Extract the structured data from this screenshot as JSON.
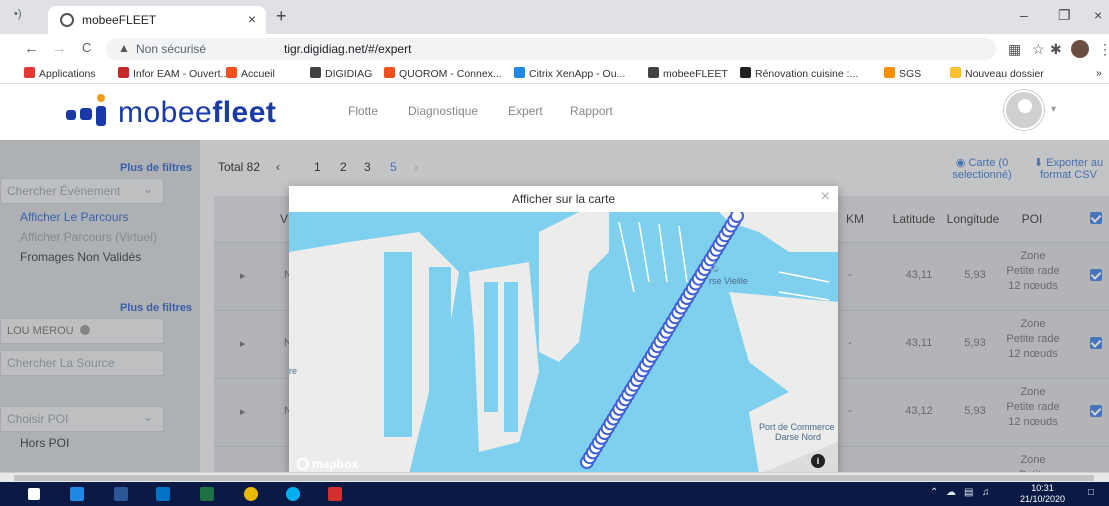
{
  "browser": {
    "tab_stub": "•)",
    "tab_title": "mobeeFLEET",
    "tab_close": "×",
    "new_tab": "+",
    "window_minimize": "–",
    "window_maximize": "❐",
    "window_close": "×",
    "back": "←",
    "forward": "→",
    "reload": "C",
    "security_label": "Non sécurisé",
    "url": "tigr.digidiag.net/#/expert",
    "bookmarks": [
      {
        "label": "Applications",
        "color": "#e53935"
      },
      {
        "label": "Infor EAM - Ouvert...",
        "color": "#c62828"
      },
      {
        "label": "Accueil",
        "color": "#f4511e"
      },
      {
        "label": "DIGIDIAG",
        "color": "#424242"
      },
      {
        "label": "QUOROM - Connex...",
        "color": "#f4511e"
      },
      {
        "label": "Citrix XenApp - Ou...",
        "color": "#1e88e5"
      },
      {
        "label": "mobeeFLEET",
        "color": "#424242"
      },
      {
        "label": "Rénovation cuisine :...",
        "color": "#212121"
      },
      {
        "label": "SGS",
        "color": "#ff8f00"
      },
      {
        "label": "Nouveau dossier",
        "color": "#fbc02d"
      }
    ],
    "bookmarks_more": "»"
  },
  "app": {
    "logo_text_light": "mobee",
    "logo_text_bold": "fleet",
    "nav": [
      "Flotte",
      "Diagnostique",
      "Expert",
      "Rapport"
    ],
    "caret": "▾"
  },
  "sidebar": {
    "more_filters_1": "Plus de filtres",
    "search_event_placeholder": "Chercher Évènement",
    "items": [
      "Afficher Le Parcours",
      "Afficher Parcours (Virtuel)",
      "Fromages Non Validés"
    ],
    "more_filters_2": "Plus de filtres",
    "chip_label": "LOU MEROU",
    "search_source_placeholder": "Chercher La Source",
    "poi_placeholder": "Choisir POI",
    "poi_item": "Hors POI",
    "dropdown_arrow": "⌄"
  },
  "table": {
    "total": "Total 82",
    "pages": [
      "‹",
      "1",
      "2",
      "3",
      "5",
      "›"
    ],
    "map_action": "◉ Carte (0 selectionné)",
    "export_action": "⬇ Exporter au format CSV",
    "headers": {
      "v": "V",
      "km": "KM",
      "lat": "Latitude",
      "lng": "Longitude",
      "poi": "POI"
    },
    "rows": [
      {
        "km": "-",
        "lat": "43,11",
        "lng": "5,93",
        "poi": "Zone Petite rade 12 nœuds",
        "expander": "▸",
        "stub": "N"
      },
      {
        "km": "-",
        "lat": "43,11",
        "lng": "5,93",
        "poi": "Zone Petite rade 12 nœuds",
        "expander": "▸",
        "stub": "N"
      },
      {
        "km": "-",
        "lat": "43,12",
        "lng": "5,93",
        "poi": "Zone Petite rade 12 nœuds",
        "expander": "▸",
        "stub": "N"
      },
      {
        "km": "",
        "lat": "",
        "lng": "",
        "poi": "Zone Petite",
        "expander": "",
        "stub": ""
      }
    ]
  },
  "modal": {
    "title": "Afficher sur la carte",
    "close": "×",
    "labels": {
      "darse_vieille": "rse Vieille",
      "port_commerce": "Port de Commerce",
      "darse_nord": "Darse Nord",
      "left_fragment": "re"
    },
    "attribution": "mapbox",
    "info": "i",
    "anchor_glyph": "⚓"
  },
  "taskbar": {
    "time": "10:31",
    "date": "21/10/2020"
  },
  "colors": {
    "brand": "#1a3aa8",
    "accent": "#f39c12",
    "water": "#7fd0ef",
    "route": "#3f5fd6"
  }
}
